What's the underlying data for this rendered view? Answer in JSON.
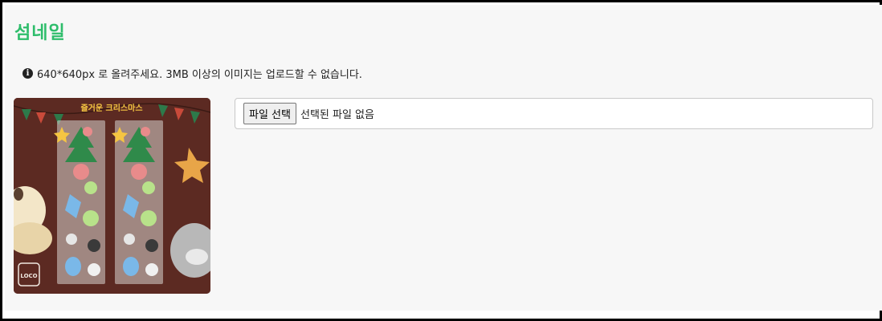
{
  "section": {
    "title": "섬네일",
    "notice": "640*640px 로 올려주세요. 3MB 이상의 이미지는 업로드할 수 없습니다.",
    "notice_icon": "info-circle-icon"
  },
  "thumbnail": {
    "banner_text": "즐거운 크리스마스",
    "logo_text": "LOCO"
  },
  "file_input": {
    "button_label": "파일 선택",
    "status": "선택된 파일 없음"
  },
  "colors": {
    "accent": "#2ebd6b",
    "panel_bg": "#f7f7f7",
    "frame_border": "#000000"
  }
}
